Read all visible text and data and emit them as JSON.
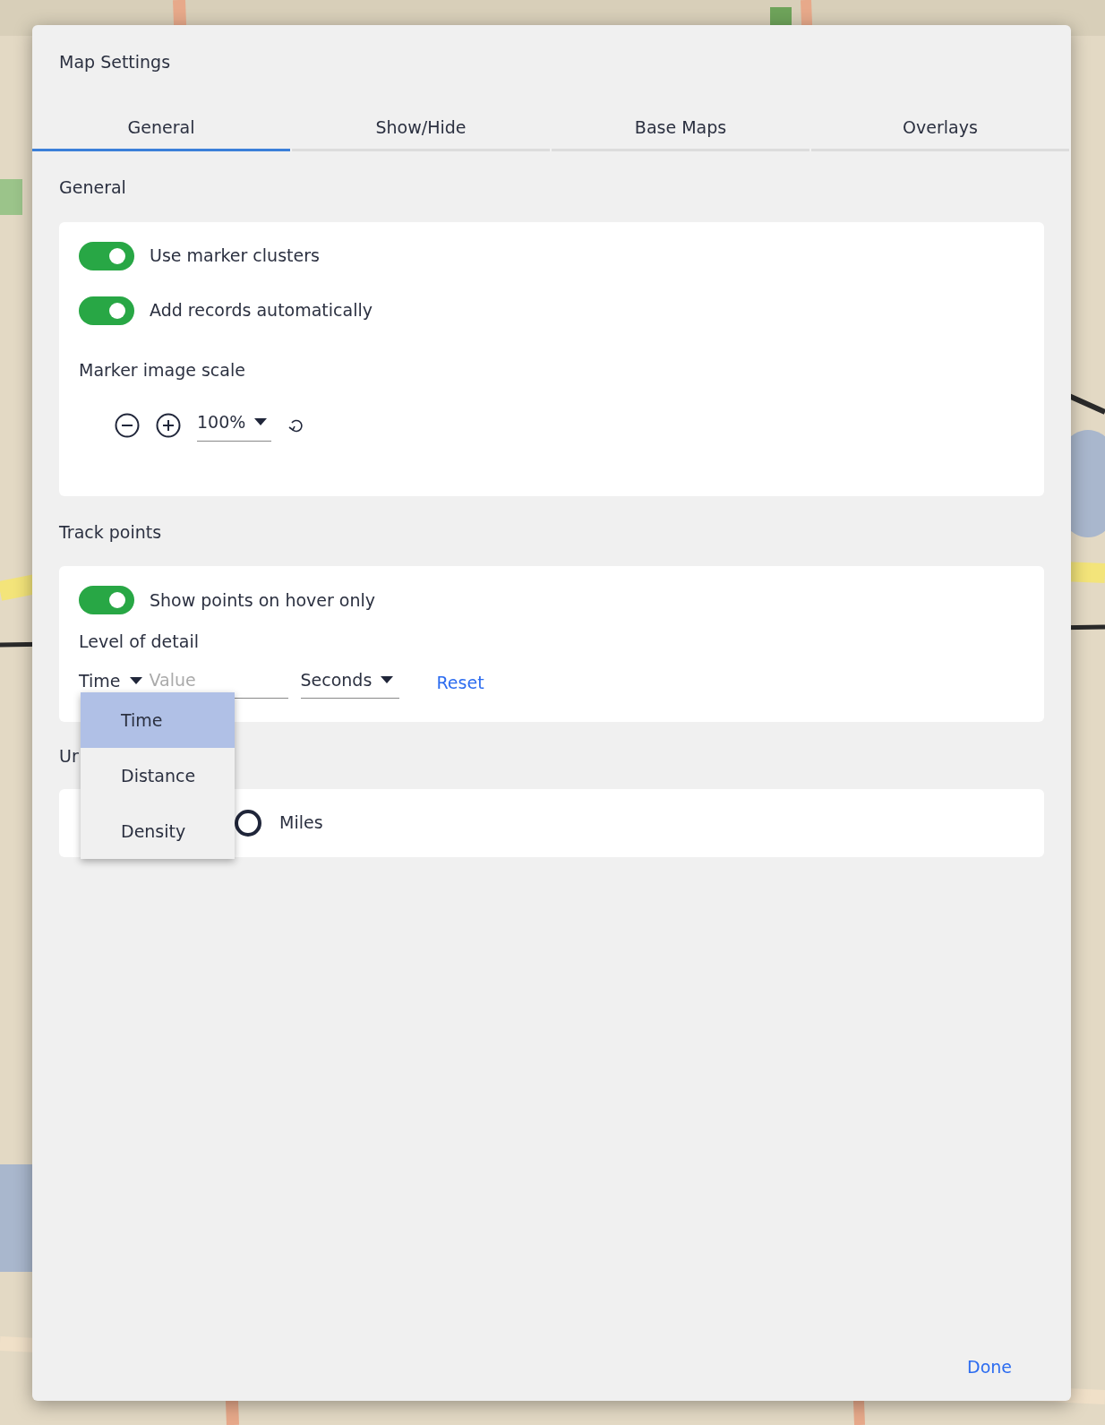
{
  "dialog": {
    "title": "Map Settings",
    "tabs": [
      {
        "label": "General",
        "selected": true
      },
      {
        "label": "Show/Hide",
        "selected": false
      },
      {
        "label": "Base Maps",
        "selected": false
      },
      {
        "label": "Overlays",
        "selected": false
      }
    ],
    "general": {
      "heading": "General",
      "toggles": [
        {
          "label": "Use marker clusters",
          "on": true
        },
        {
          "label": "Add records automatically",
          "on": true
        }
      ],
      "scale_label": "Marker image scale",
      "scale_value": "100%"
    },
    "track_points": {
      "heading": "Track points",
      "toggle": {
        "label": "Show points on hover only",
        "on": true
      },
      "detail_label": "Level of detail",
      "mode_select": "Time",
      "value_placeholder": "Value",
      "unit_select": "Seconds",
      "reset": "Reset",
      "menu": [
        {
          "label": "Time",
          "selected": true
        },
        {
          "label": "Distance",
          "selected": false
        },
        {
          "label": "Density",
          "selected": false
        }
      ]
    },
    "units": {
      "heading": "Ur",
      "options": [
        {
          "label": "Miles",
          "selected": false
        }
      ]
    },
    "done": "Done"
  }
}
